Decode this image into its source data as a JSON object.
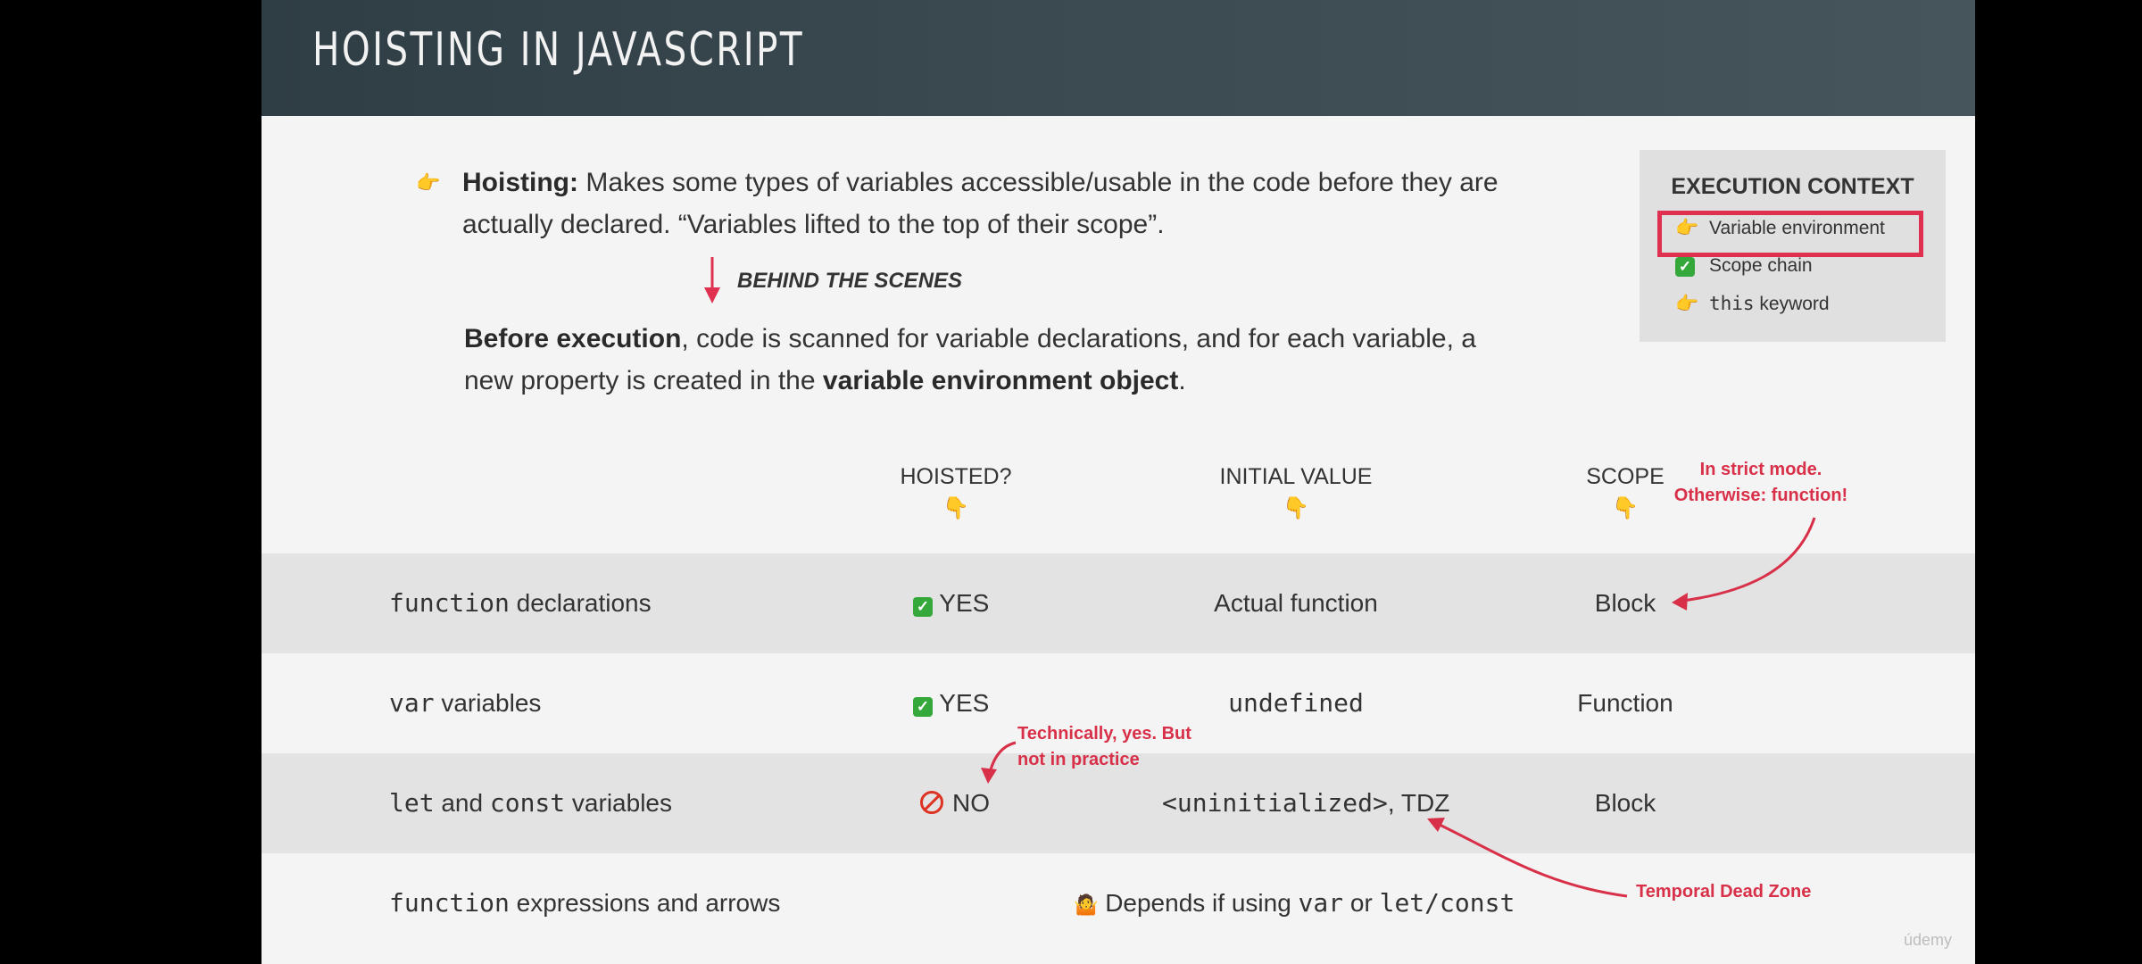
{
  "slide": {
    "title": "Hoisting in JavaScript",
    "hoisting_term": "Hoisting:",
    "hoisting_text": "Makes some types of variables accessible/usable in the code before they are actually declared. “Variables lifted to the top of their scope”.",
    "behind_the_scenes": "BEHIND THE SCENES",
    "before_execution": "Before execution",
    "before_text_1": ", code is scanned for variable declarations, and for each variable, a new property is created in the ",
    "variable_env_object": "variable environment object",
    "period": "."
  },
  "execution_context": {
    "title": "EXECUTION CONTEXT",
    "items": [
      {
        "code": "",
        "label": "Variable environment",
        "icon": "pointing-hand-icon",
        "highlighted": true
      },
      {
        "code": "",
        "label": "Scope chain",
        "icon": "check-icon",
        "highlighted": false
      },
      {
        "code": "this",
        "label": " keyword",
        "icon": "pointing-hand-icon",
        "highlighted": false
      }
    ]
  },
  "table": {
    "headers": {
      "hoisted": "HOISTED?",
      "initial_value": "INITIAL VALUE",
      "scope": "SCOPE"
    },
    "rows": [
      {
        "code": "function",
        "label": " declarations",
        "hoisted": "YES",
        "hoisted_icon": "check-icon",
        "initial": "Actual function",
        "scope": "Block"
      },
      {
        "code": "var",
        "label": " variables",
        "hoisted": "YES",
        "hoisted_icon": "check-icon",
        "initial": "undefined",
        "scope": "Function"
      },
      {
        "code1": "let",
        "mid": " and ",
        "code2": "const",
        "label": " variables",
        "hoisted": "NO",
        "hoisted_icon": "prohibited-icon",
        "initial_code": "<uninitialized>",
        "initial_rest": ", TDZ",
        "scope": "Block"
      },
      {
        "code": "function",
        "label": " expressions and arrows",
        "depends_1": "Depends if using ",
        "depends_code1": "var",
        "depends_2": " or ",
        "depends_code2": "let/const"
      }
    ]
  },
  "annotations": {
    "strict_1": "In strict mode.",
    "strict_2": "Otherwise: function!",
    "technically_1": "Technically, yes. But",
    "technically_2": "not in practice",
    "tdz": "Temporal Dead Zone"
  },
  "colors": {
    "accent": "#e0304f",
    "header": "#3b4a51",
    "check": "#34a83a"
  },
  "watermark": "údemy"
}
